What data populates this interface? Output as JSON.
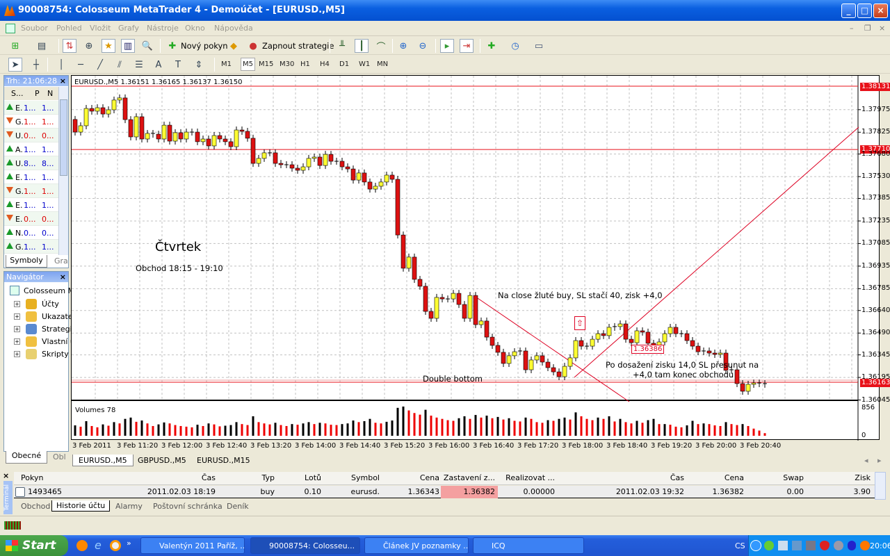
{
  "window": {
    "title": "90008754: Colosseum MetaTrader 4 - Demoúčet - [EURUSD.,M5]",
    "min": "_",
    "max": "□",
    "close": "×"
  },
  "menu": [
    "Soubor",
    "Pohled",
    "Vložit",
    "Grafy",
    "Nástroje",
    "Okno",
    "Nápověda"
  ],
  "toolbar": {
    "new_order": "Nový pokyn",
    "expert": "Zapnout strategie",
    "timeframes": [
      "M1",
      "M5",
      "M15",
      "M30",
      "H1",
      "H4",
      "D1",
      "W1",
      "MN"
    ],
    "active_tf": "M5",
    "draw_tools": {
      "text": "A",
      "label": "T"
    }
  },
  "market_watch": {
    "title": "Trh: 21:06:28",
    "cols": [
      "S...",
      "P",
      "N"
    ],
    "rows": [
      {
        "symbol": "E.",
        "bid": "1...",
        "ask": "1...",
        "dir": "up"
      },
      {
        "symbol": "G.",
        "bid": "1...",
        "ask": "1...",
        "dir": "down"
      },
      {
        "symbol": "U.",
        "bid": "0...",
        "ask": "0...",
        "dir": "down"
      },
      {
        "symbol": "A.",
        "bid": "1...",
        "ask": "1...",
        "dir": "up"
      },
      {
        "symbol": "U.",
        "bid": "8...",
        "ask": "8...",
        "dir": "up"
      },
      {
        "symbol": "E.",
        "bid": "1...",
        "ask": "1...",
        "dir": "up"
      },
      {
        "symbol": "G.",
        "bid": "1...",
        "ask": "1...",
        "dir": "down"
      },
      {
        "symbol": "E.",
        "bid": "1...",
        "ask": "1...",
        "dir": "up"
      },
      {
        "symbol": "E.",
        "bid": "0...",
        "ask": "0...",
        "dir": "down"
      },
      {
        "symbol": "N.",
        "bid": "0...",
        "ask": "0...",
        "dir": "up"
      },
      {
        "symbol": "G.",
        "bid": "1...",
        "ask": "1...",
        "dir": "up"
      }
    ],
    "tabs": [
      "Symboly",
      "Gra"
    ]
  },
  "navigator": {
    "title": "Navigátor",
    "root": "Colosseum M",
    "items": [
      "Účty",
      "Ukazatel",
      "Strategie",
      "Vlastní u",
      "Skripty"
    ],
    "tabs": [
      "Obecné",
      "Obl"
    ]
  },
  "chart": {
    "header": "EURUSD.,M5  1.36151 1.36165 1.36137 1.36150",
    "volumes_label": "Volumes 78",
    "vol_max_label": "856",
    "vol_min_label": "0",
    "annotations": {
      "day": "Čtvrtek",
      "trade": "Obchod 18:15 - 19:10",
      "note1": "Na close žluté buy, SL stačí 40, zisk +4,0",
      "double_bottom": "Double bottom",
      "note2a": "Po dosažení zisku 14,0 SL přesunut na",
      "note2b": "+4,0 tam konec obchodu",
      "sl_label": "1.36386"
    },
    "price_lines": [
      "1.38131",
      "1.37710",
      "1.36163"
    ],
    "tabs": [
      "EURUSD.,M5",
      "GBPUSD.,M5",
      "EURUSD.,M15"
    ],
    "colors": {
      "bull": "#ffff33",
      "bear": "#dd1111",
      "line": "#e8121a",
      "grid": "#c0c0c0"
    }
  },
  "chart_data": {
    "type": "candlestick",
    "title": "EURUSD.,M5",
    "first_open": 1.3791,
    "ylim": [
      1.36,
      1.382
    ],
    "yticks": [
      "1.37975",
      "1.37825",
      "1.37680",
      "1.37530",
      "1.37385",
      "1.37235",
      "1.37085",
      "1.36935",
      "1.36785",
      "1.36640",
      "1.36490",
      "1.36345",
      "1.36195",
      "1.36045"
    ],
    "xticks": [
      "3 Feb 2011",
      "3 Feb 11:20",
      "3 Feb 12:00",
      "3 Feb 12:40",
      "3 Feb 13:20",
      "3 Feb 14:00",
      "3 Feb 14:40",
      "3 Feb 15:20",
      "3 Feb 16:00",
      "3 Feb 16:40",
      "3 Feb 17:20",
      "3 Feb 18:00",
      "3 Feb 18:40",
      "3 Feb 19:20",
      "3 Feb 20:00",
      "3 Feb 20:40"
    ],
    "close": [
      1.37826,
      1.37868,
      1.37983,
      1.37965,
      1.37988,
      1.37946,
      1.37974,
      1.38039,
      1.38053,
      1.37909,
      1.37794,
      1.37928,
      1.3778,
      1.37817,
      1.37812,
      1.3778,
      1.37872,
      1.37766,
      1.37822,
      1.3778,
      1.37826,
      1.37826,
      1.37762,
      1.3778,
      1.37734,
      1.37803,
      1.3778,
      1.37762,
      1.37729,
      1.3784,
      1.37831,
      1.37785,
      1.37618,
      1.37651,
      1.37688,
      1.37688,
      1.37618,
      1.37609,
      1.37609,
      1.37586,
      1.37572,
      1.37595,
      1.37651,
      1.3766,
      1.37604,
      1.37678,
      1.37632,
      1.37632,
      1.37595,
      1.37581,
      1.37507,
      1.37554,
      1.37494,
      1.37447,
      1.37466,
      1.37494,
      1.3754,
      1.37512,
      1.37142,
      1.36921,
      1.36995,
      1.36847,
      1.36801,
      1.36634,
      1.36588,
      1.36727,
      1.36717,
      1.36717,
      1.36754,
      1.3668,
      1.36588,
      1.3674,
      1.36546,
      1.3657,
      1.36463,
      1.36408,
      1.36362,
      1.36288,
      1.36339,
      1.36366,
      1.36371,
      1.36246,
      1.36311,
      1.36339,
      1.36297,
      1.3626,
      1.36232,
      1.362,
      1.36269,
      1.36325,
      1.3644,
      1.36403,
      1.36403,
      1.36449,
      1.36486,
      1.36473,
      1.36528,
      1.36533,
      1.36551,
      1.36449,
      1.36426,
      1.36505,
      1.36496,
      1.36422,
      1.3638,
      1.36431,
      1.36486,
      1.36528,
      1.36486,
      1.36486,
      1.3644,
      1.36403,
      1.36366,
      1.36371,
      1.36357,
      1.36348,
      1.36357,
      1.36242,
      1.36246,
      1.36154,
      1.36103,
      1.36149,
      1.36158,
      1.36154,
      1.3615
    ],
    "volume": [
      320,
      280,
      450,
      300,
      260,
      350,
      310,
      420,
      380,
      520,
      560,
      430,
      470,
      380,
      300,
      350,
      410,
      380,
      330,
      300,
      280,
      260,
      340,
      300,
      380,
      350,
      290,
      310,
      330,
      420,
      360,
      330,
      600,
      420,
      380,
      350,
      400,
      330,
      300,
      360,
      340,
      380,
      420,
      360,
      400,
      380,
      340,
      330,
      360,
      380,
      470,
      420,
      450,
      520,
      400,
      380,
      430,
      470,
      860,
      900,
      780,
      700,
      650,
      800,
      620,
      560,
      520,
      480,
      460,
      540,
      600,
      520,
      640,
      560,
      620,
      540,
      580,
      500,
      540,
      460,
      440,
      560,
      520,
      420,
      400,
      480,
      460,
      520,
      560,
      500,
      720,
      600,
      520,
      480,
      560,
      520,
      600,
      440,
      520,
      420,
      380,
      460,
      400,
      480,
      520,
      360,
      360,
      340,
      280,
      260,
      320,
      460,
      360,
      380,
      360,
      320,
      300,
      420,
      360,
      330,
      360,
      300,
      220,
      160,
      80
    ]
  },
  "terminal": {
    "label": "Terminál",
    "headers": [
      "Pokyn",
      "Čas",
      "Typ",
      "Lotů",
      "Symbol",
      "Cena",
      "Zastavení z...",
      "Realizovat ...",
      "Čas",
      "Cena",
      "Swap",
      "Zisk"
    ],
    "row": [
      "1493465",
      "2011.02.03 18:19",
      "buy",
      "0.10",
      "eurusd.",
      "1.36343",
      "1.36382",
      "0.00000",
      "2011.02.03 19:32",
      "1.36382",
      "0.00",
      "3.90"
    ],
    "tabs": [
      "Obchod",
      "Historie účtu",
      "Alarmy",
      "Poštovní schránka",
      "Deník"
    ],
    "active_tab": "Historie účtu"
  },
  "taskbar": {
    "start": "Start",
    "tasks": [
      "Valentýn 2011 Paříž, ...",
      "90008754: Colosseu...",
      "Článek JV poznamky ...",
      "ICQ"
    ],
    "lang": "CS",
    "clock": "20:06"
  }
}
